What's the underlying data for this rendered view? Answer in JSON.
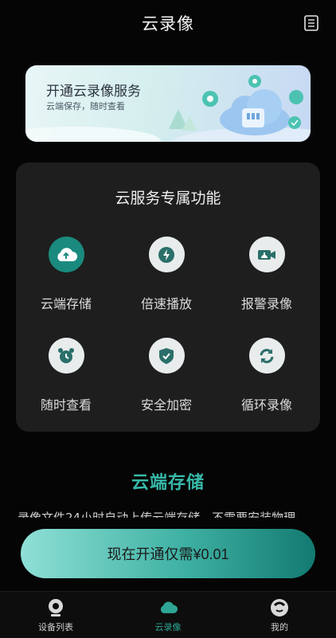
{
  "header": {
    "title": "云录像"
  },
  "banner": {
    "title": "开通云录像服务",
    "subtitle": "云端保存，随时查看"
  },
  "panel": {
    "title": "云服务专属功能",
    "features": [
      {
        "label": "云端存储",
        "icon": "cloud-upload-icon"
      },
      {
        "label": "倍速播放",
        "icon": "lightning-icon"
      },
      {
        "label": "报警录像",
        "icon": "alarm-camera-icon"
      },
      {
        "label": "随时查看",
        "icon": "alarm-clock-icon"
      },
      {
        "label": "安全加密",
        "icon": "shield-check-icon"
      },
      {
        "label": "循环录像",
        "icon": "cycle-icon"
      }
    ]
  },
  "section": {
    "title": "云端存储",
    "description": "录像文件24小时自动上传云端存储，不需要安装物理"
  },
  "cta": {
    "label": "现在开通仅需¥0.01"
  },
  "tabbar": {
    "items": [
      {
        "label": "设备列表",
        "active": false
      },
      {
        "label": "云录像",
        "active": true
      },
      {
        "label": "我的",
        "active": false
      }
    ]
  },
  "colors": {
    "accent": "#2ea595",
    "panel": "#1e1e1e",
    "background": "#050505"
  }
}
